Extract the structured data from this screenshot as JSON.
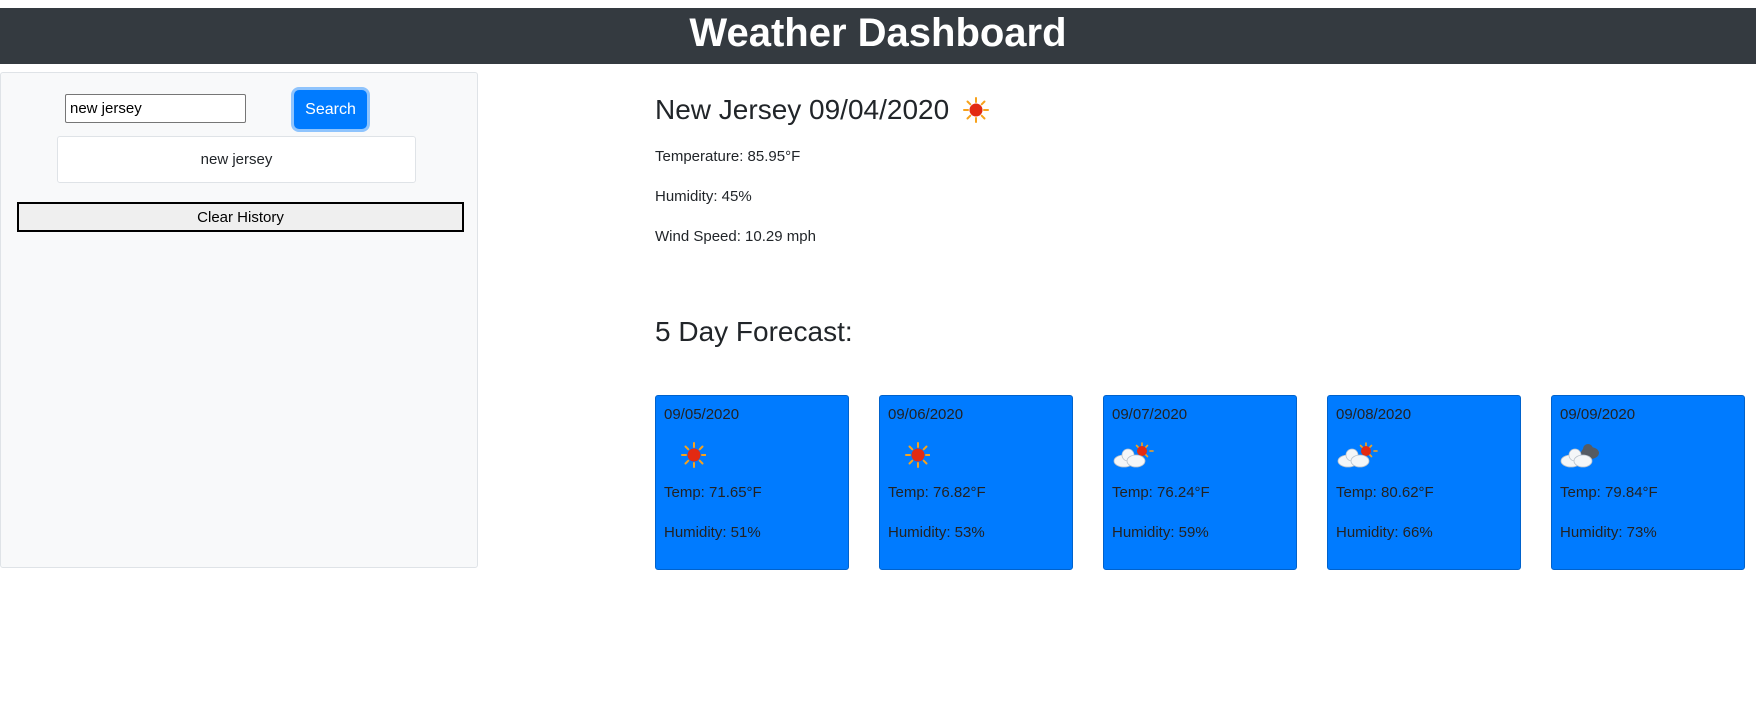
{
  "header": {
    "title": "Weather Dashboard"
  },
  "search": {
    "input_value": "new jersey",
    "button_label": "Search",
    "history": [
      "new jersey"
    ],
    "clear_label": "Clear History"
  },
  "current": {
    "title": "New Jersey 09/04/2020",
    "icon": "sun-icon",
    "temperature": "Temperature: 85.95°F",
    "humidity": "Humidity: 45%",
    "wind": "Wind Speed: 10.29 mph"
  },
  "forecast": {
    "title": "5 Day Forecast:",
    "card_color": "#007bff",
    "days": [
      {
        "date": "09/05/2020",
        "icon": "sun-icon",
        "temp": "Temp: 71.65°F",
        "humidity": "Humidity: 51%"
      },
      {
        "date": "09/06/2020",
        "icon": "sun-icon",
        "temp": "Temp: 76.82°F",
        "humidity": "Humidity: 53%"
      },
      {
        "date": "09/07/2020",
        "icon": "partly-cloudy-icon",
        "temp": "Temp: 76.24°F",
        "humidity": "Humidity: 59%"
      },
      {
        "date": "09/08/2020",
        "icon": "partly-cloudy-icon",
        "temp": "Temp: 80.62°F",
        "humidity": "Humidity: 66%"
      },
      {
        "date": "09/09/2020",
        "icon": "cloudy-icon",
        "temp": "Temp: 79.84°F",
        "humidity": "Humidity: 73%"
      }
    ]
  }
}
